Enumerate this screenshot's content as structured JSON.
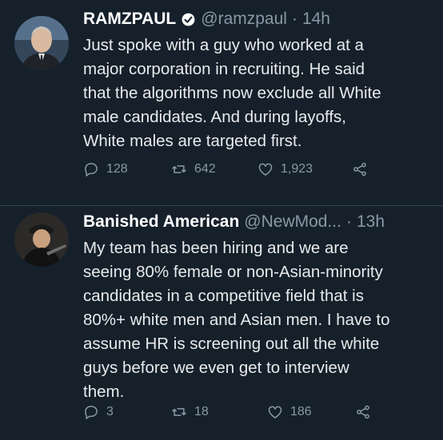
{
  "tweets": [
    {
      "name": "RAMZPAUL",
      "verified": true,
      "handle": "@ramzpaul",
      "separator": "·",
      "time": "14h",
      "text": "Just spoke with a guy who worked at a\nmajor corporation in recruiting. He said\nthat the algorithms now exclude all White\nmale candidates. And during layoffs,\nWhite males are targeted first.",
      "replies": "128",
      "retweets": "642",
      "likes": "1,923"
    },
    {
      "name": "Banished American",
      "verified": false,
      "handle": "@NewMod...",
      "separator": "·",
      "time": "13h",
      "text": "My team has been hiring and we are\nseeing 80% female or non-Asian-minority\ncandidates in a competitive field that is\n80%+ white men and Asian men. I have to\nassume HR is screening out all the white\nguys before we even get to interview\nthem.",
      "replies": "3",
      "retweets": "18",
      "likes": "186"
    }
  ],
  "colors": {
    "background": "#15202b",
    "secondary_text": "#8b98a5",
    "primary_text": "#e8eaec",
    "verified_badge": "#ffffff"
  },
  "icons": [
    "reply-icon",
    "retweet-icon",
    "like-icon",
    "share-icon",
    "verified-icon"
  ]
}
